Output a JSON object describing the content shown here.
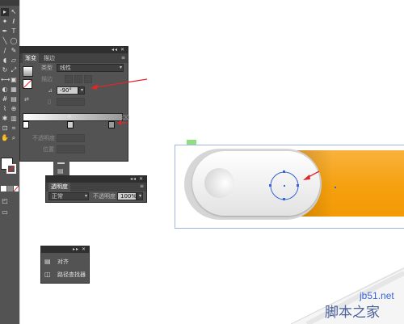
{
  "gradient_panel": {
    "tabs": [
      "渐变",
      "描边"
    ],
    "type_label": "类型",
    "type_value": "线性",
    "stroke_label": "描边",
    "angle_value": "-90°",
    "opacity_label": "不透明度",
    "position_label": "位置"
  },
  "transparency_panel": {
    "tab": "透明度",
    "blend_mode": "正常",
    "opacity_label": "不透明度",
    "opacity_value": "100%"
  },
  "align_panel": {
    "items": [
      "对齐",
      "路径查找器"
    ]
  },
  "watermark": {
    "url": "jb51.net",
    "name": "脚本之家"
  },
  "colors": {
    "panel_bg": "#535353",
    "panel_header": "#2f2f2f",
    "accent_orange": "#f5a00e",
    "annotation_red": "#e0262a",
    "selection_blue": "#3a63d6"
  }
}
